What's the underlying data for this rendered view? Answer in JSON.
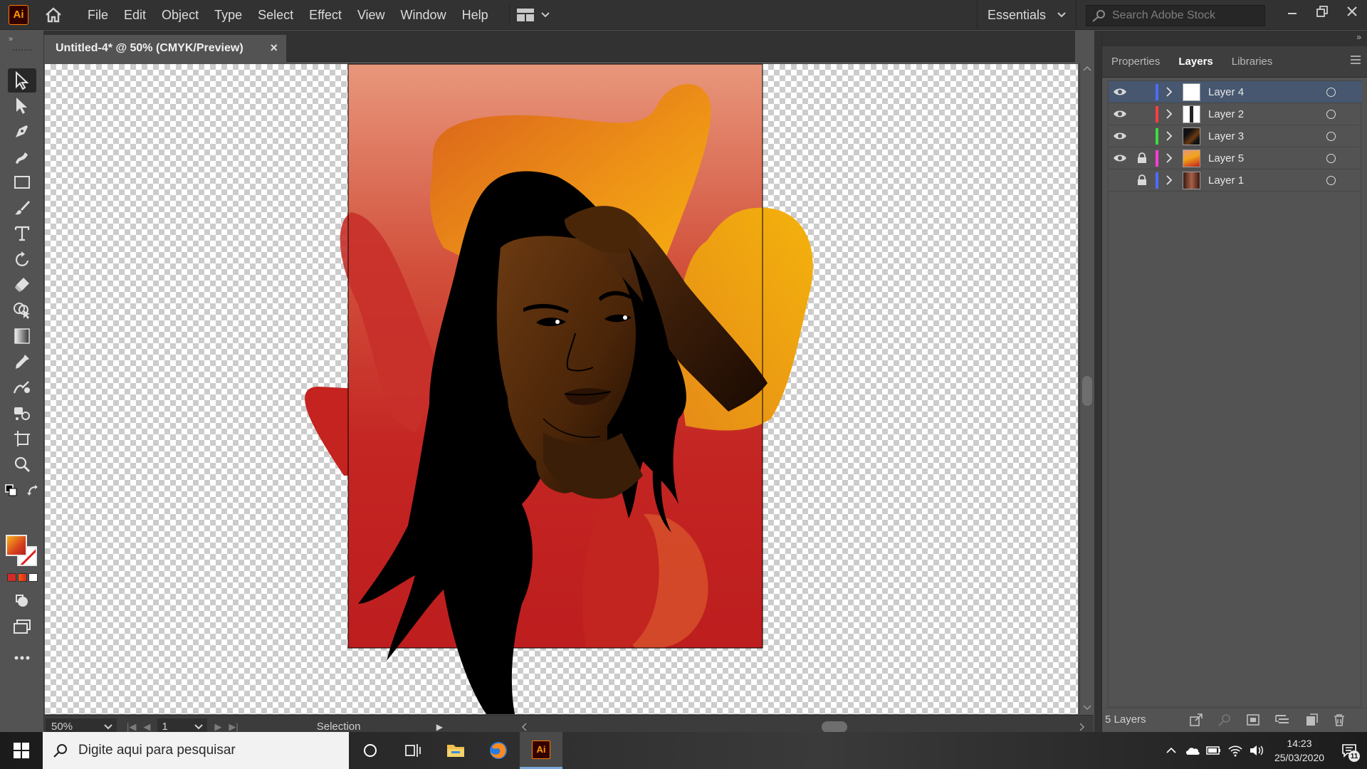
{
  "app": {
    "logo_text": "Ai",
    "menu": [
      "File",
      "Edit",
      "Object",
      "Type",
      "Select",
      "Effect",
      "View",
      "Window",
      "Help"
    ],
    "workspace": "Essentials",
    "stock_search_placeholder": "Search Adobe Stock"
  },
  "document": {
    "tab_title": "Untitled-4* @ 50% (CMYK/Preview)",
    "close_glyph": "×"
  },
  "statusbar": {
    "zoom": "50%",
    "artboard": "1",
    "tool_label": "Selection"
  },
  "panel": {
    "tabs": [
      "Properties",
      "Layers",
      "Libraries"
    ],
    "active_tab": "Layers",
    "layers": [
      {
        "name": "Layer 4",
        "visible": true,
        "locked": false,
        "color": "#4d6cff",
        "selected": true
      },
      {
        "name": "Layer 2",
        "visible": true,
        "locked": false,
        "color": "#ff4040",
        "selected": false
      },
      {
        "name": "Layer 3",
        "visible": true,
        "locked": false,
        "color": "#3cdc3c",
        "selected": false
      },
      {
        "name": "Layer 5",
        "visible": true,
        "locked": true,
        "color": "#ff3cd8",
        "selected": false
      },
      {
        "name": "Layer 1",
        "visible": false,
        "locked": true,
        "color": "#4d6cff",
        "selected": false
      }
    ],
    "layers_count": "5 Layers"
  },
  "taskbar": {
    "search_text": "Digite aqui para pesquisar",
    "time": "14:23",
    "date": "25/03/2020",
    "notification_count": "11"
  },
  "colors": {
    "artboard_top": "#e8967a",
    "artboard_bottom": "#c01e1e",
    "blob_orange": "#f2a51a",
    "skin": "#5a2e0c",
    "hair": "#000000"
  }
}
